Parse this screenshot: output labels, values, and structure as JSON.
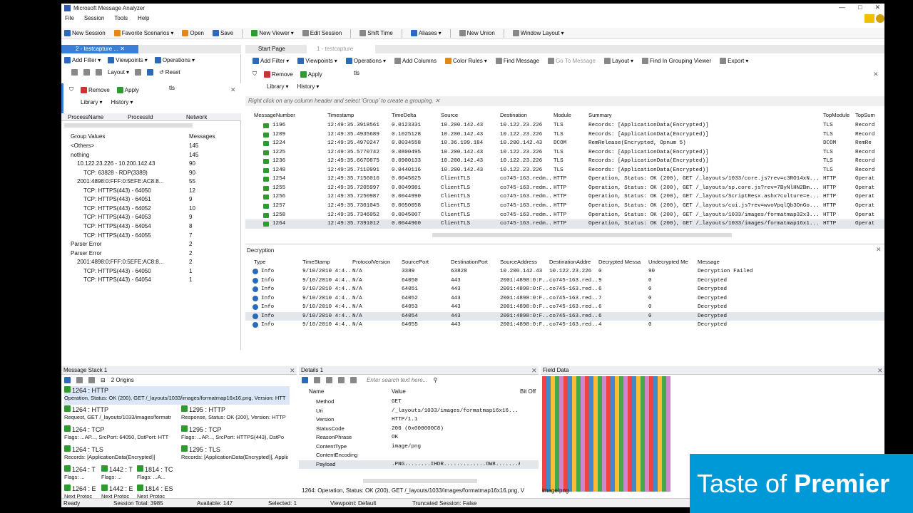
{
  "window": {
    "title": "Microsoft Message Analyzer",
    "min": "—",
    "max": "□",
    "close": "✕"
  },
  "menu": [
    "File",
    "Session",
    "Tools",
    "Help"
  ],
  "toolbar": [
    "New Session",
    "Favorite Scenarios",
    "Open",
    "Save",
    "New Viewer",
    "Edit Session",
    "Shift Time",
    "Aliases",
    "New Union",
    "Window Layout"
  ],
  "left": {
    "tab": "2 - testcapture ...",
    "tb1": [
      "Add Filter",
      "Viewpoints",
      "Operations"
    ],
    "tb2": [
      "Layout",
      "Reset"
    ],
    "filter": {
      "remove": "Remove",
      "apply": "Apply",
      "text": "tls",
      "library": "Library",
      "history": "History"
    },
    "headers": [
      "ProcessName",
      "ProcessId",
      "Network"
    ],
    "groupHeaders": {
      "values": "Group Values",
      "messages": "Messages"
    },
    "groups": [
      {
        "label": "<Others>",
        "count": "145",
        "indent": 1
      },
      {
        "label": "nothing",
        "count": "145",
        "indent": 1
      },
      {
        "label": "10.122.23.226 - 10.200.142.43",
        "count": "90",
        "indent": 2
      },
      {
        "label": "TCP: 63828 - RDP(3389)",
        "count": "90",
        "indent": 3
      },
      {
        "label": "2001:4898:0:FFF:0:5EFE:AC8:8...",
        "count": "55",
        "indent": 2
      },
      {
        "label": "TCP: HTTPS(443) - 64050",
        "count": "12",
        "indent": 3
      },
      {
        "label": "TCP: HTTPS(443) - 64051",
        "count": "9",
        "indent": 3
      },
      {
        "label": "TCP: HTTPS(443) - 64052",
        "count": "10",
        "indent": 3
      },
      {
        "label": "TCP: HTTPS(443) - 64053",
        "count": "9",
        "indent": 3
      },
      {
        "label": "TCP: HTTPS(443) - 64054",
        "count": "8",
        "indent": 3
      },
      {
        "label": "TCP: HTTPS(443) - 64055",
        "count": "7",
        "indent": 3
      },
      {
        "label": "Parser Error",
        "count": "2",
        "indent": 1
      },
      {
        "label": "Parser Error",
        "count": "2",
        "indent": 1
      },
      {
        "label": "2001:4898:0:FFF:0:5EFE:AC8:8...",
        "count": "2",
        "indent": 2
      },
      {
        "label": "TCP: HTTPS(443) - 64050",
        "count": "1",
        "indent": 3
      },
      {
        "label": "TCP: HTTPS(443) - 64054",
        "count": "1",
        "indent": 3
      }
    ]
  },
  "right": {
    "tabs": [
      "Start Page",
      "1 - testcapture"
    ],
    "tb1": [
      "Add Filter",
      "Viewpoints",
      "Operations",
      "Add Columns",
      "Color Rules",
      "Find Message",
      "Go To Message",
      "Layout",
      "Find In Grouping Viewer",
      "Export"
    ],
    "filter": {
      "remove": "Remove",
      "apply": "Apply",
      "text": "tls",
      "library": "Library",
      "history": "History"
    },
    "banner": "Right click on any column header and select 'Group' to create a grouping.",
    "columns": [
      "MessageNumber",
      "Timestamp",
      "TimeDelta",
      "Source",
      "Destination",
      "Module",
      "Summary",
      "TopModule",
      "TopSum"
    ],
    "rows": [
      [
        "1196",
        "12:49:35.3918561",
        "0.0123331",
        "10.200.142.43",
        "10.122.23.226",
        "TLS",
        "Records: [ApplicationData(Encrypted)]",
        "TLS",
        "Record"
      ],
      [
        "1209",
        "12:49:35.4935689",
        "0.1025128",
        "10.200.142.43",
        "10.122.23.226",
        "TLS",
        "Records: [ApplicationData(Encrypted)]",
        "TLS",
        "Record"
      ],
      [
        "1224",
        "12:49:35.4970247",
        "0.0034558",
        "10.36.199.184",
        "10.200.142.43",
        "DCOM",
        "RemRelease(Encrypted, Opnum 5)",
        "DCOM",
        "RemRe"
      ],
      [
        "1225",
        "12:49:35.5770742",
        "0.0800495",
        "10.200.142.43",
        "10.122.23.226",
        "TLS",
        "Records: [ApplicationData(Encrypted)]",
        "TLS",
        "Record"
      ],
      [
        "1236",
        "12:49:35.6670875",
        "0.0900133",
        "10.200.142.43",
        "10.122.23.226",
        "TLS",
        "Records: [ApplicationData(Encrypted)]",
        "TLS",
        "Record"
      ],
      [
        "1248",
        "12:49:35.7110991",
        "0.0440116",
        "10.200.142.43",
        "10.122.23.226",
        "TLS",
        "Records: [ApplicationData(Encrypted)]",
        "TLS",
        "Record"
      ],
      [
        "1254",
        "12:49:35.7156016",
        "0.0045025",
        "ClientTLS",
        "co745-163.redm...",
        "HTTP",
        "Operation, Status: OK (200), GET /_layouts/1033/core.js?rev=c3RO14xN...",
        "HTTP",
        "Operat"
      ],
      [
        "1255",
        "12:49:35.7205997",
        "0.0049981",
        "ClientTLS",
        "co745-163.redm...",
        "HTTP",
        "Operation, Status: OK (200), GET /_layouts/sp.core.js?rev=7ByNlHN2Bm...",
        "HTTP",
        "Operat"
      ],
      [
        "1256",
        "12:49:35.7250987",
        "0.0044990",
        "ClientTLS",
        "co745-163.redm...",
        "HTTP",
        "Operation, Status: OK (200), GET /_layouts/ScriptResx.ashx?culture=e...",
        "HTTP",
        "Operat"
      ],
      [
        "1257",
        "12:49:35.7301045",
        "0.0050058",
        "ClientTLS",
        "co745-163.redm...",
        "HTTP",
        "Operation, Status: OK (200), GET /_layouts/cui.js?rev=wvoVpqlQb3OnGo...",
        "HTTP",
        "Operat"
      ],
      [
        "1258",
        "12:49:35.7346052",
        "0.0045007",
        "ClientTLS",
        "co745-163.redm...",
        "HTTP",
        "Operation, Status: OK (200), GET /_layouts/1033/images/formatmap32x3...",
        "HTTP",
        "Operat"
      ],
      [
        "1264",
        "12:49:35.7391012",
        "0.0044960",
        "ClientTLS",
        "co745-163.redm...",
        "HTTP",
        "Operation, Status: OK (200), GET /_layouts/1033/images/formatmap16x1...",
        "HTTP",
        "Operat"
      ]
    ]
  },
  "decryption": {
    "title": "Decryption",
    "columns": [
      "Type",
      "TimeStamp",
      "ProtocolVersion",
      "SourcePort",
      "DestinationPort",
      "SourceAddress",
      "DestinationAddre",
      "Decrypted Messa",
      "Undecrypted Me",
      "Message"
    ],
    "rows": [
      [
        "Info",
        "9/10/2010 4:4...",
        "N/A",
        "3389",
        "63828",
        "10.200.142.43",
        "10.122.23.226",
        "0",
        "90",
        "Decryption Failed"
      ],
      [
        "Info",
        "9/10/2010 4:4...",
        "N/A",
        "64050",
        "443",
        "2001:4898:0:F...",
        "co745-163.red...",
        "9",
        "0",
        "Decrypted"
      ],
      [
        "Info",
        "9/10/2010 4:4...",
        "N/A",
        "64051",
        "443",
        "2001:4898:0:F...",
        "co745-163.red...",
        "6",
        "0",
        "Decrypted"
      ],
      [
        "Info",
        "9/10/2010 4:4...",
        "N/A",
        "64052",
        "443",
        "2001:4898:0:F...",
        "co745-163.red...",
        "7",
        "0",
        "Decrypted"
      ],
      [
        "Info",
        "9/10/2010 4:4...",
        "N/A",
        "64053",
        "443",
        "2001:4898:0:F...",
        "co745-163.red...",
        "6",
        "0",
        "Decrypted"
      ],
      [
        "Info",
        "9/10/2010 4:4...",
        "N/A",
        "64054",
        "443",
        "2001:4898:0:F...",
        "co745-163.red...",
        "6",
        "0",
        "Decrypted"
      ],
      [
        "Info",
        "9/10/2010 4:4...",
        "N/A",
        "64055",
        "443",
        "2001:4898:0:F...",
        "co745-163.red...",
        "4",
        "0",
        "Decrypted"
      ]
    ]
  },
  "stack": {
    "title": "Message Stack 1",
    "origins": "2 Origins",
    "items": [
      {
        "h": "1264 : HTTP",
        "d": "Operation, Status: OK (200), GET /_layouts/1033/images/formatmap16x16.png, Version: HTT"
      },
      {
        "h": "1264 : HTTP",
        "d": "Request, GET /_layouts/1033/images/formatma"
      },
      {
        "h": "1295 : HTTP",
        "d": "Response, Status: OK (200), Version: HTTP"
      },
      {
        "h": "1264 : TCP",
        "d": "Flags: ...AP..., SrcPort: 64050, DstPort: HTT"
      },
      {
        "h": "1295 : TCP",
        "d": "Flags: ...AP..., SrcPort: HTTPS(443), DstPo"
      },
      {
        "h": "1264 : TLS",
        "d": "Records: [ApplicationData(Encrypted)]"
      },
      {
        "h": "1295 : TLS",
        "d": "Records: [ApplicationData(Encrypted)], Applic"
      },
      {
        "h": "1264 : T",
        "d": "Flags: ..."
      },
      {
        "h": "1442 : T",
        "d": "Flags: ..."
      },
      {
        "h": "1814 : TC",
        "d": "Flags: ...A..."
      },
      {
        "h": "1264 : E",
        "d": "Next Protoc"
      },
      {
        "h": "1442 : E",
        "d": "Next Protoc"
      },
      {
        "h": "1814 : ES",
        "d": "Next Protoc"
      }
    ]
  },
  "details": {
    "title": "Details 1",
    "search": "Enter search text here...",
    "columns": [
      "Name",
      "Value",
      "Bit Off"
    ],
    "rows": [
      [
        "Method",
        "GET"
      ],
      [
        "Uri",
        "/_layouts/1033/images/formatmap16x16..."
      ],
      [
        "Version",
        "HTTP/1.1"
      ],
      [
        "StatusCode",
        "200 (0x000000C8)"
      ],
      [
        "ReasonPhrase",
        "OK"
      ],
      [
        "ContentType",
        "image/png"
      ],
      [
        "ContentEncoding",
        ""
      ],
      [
        "Payload",
        ".PNG........IHDR.............OW8.......&"
      ]
    ],
    "footer": "1264: Operation, Status: OK (200), GET /_layouts/1033/images/formatmap16x16.png, V"
  },
  "fielddata": {
    "title": "Field Data",
    "footer": "image/png"
  },
  "status": {
    "ready": "Ready",
    "total": "Session Total: 3985",
    "available": "Available: 147",
    "selected": "Selected: 1",
    "viewpoint": "Viewpoint: Default",
    "truncated": "Truncated Session: False"
  },
  "brand": {
    "a": "Taste of ",
    "b": "Premier"
  }
}
